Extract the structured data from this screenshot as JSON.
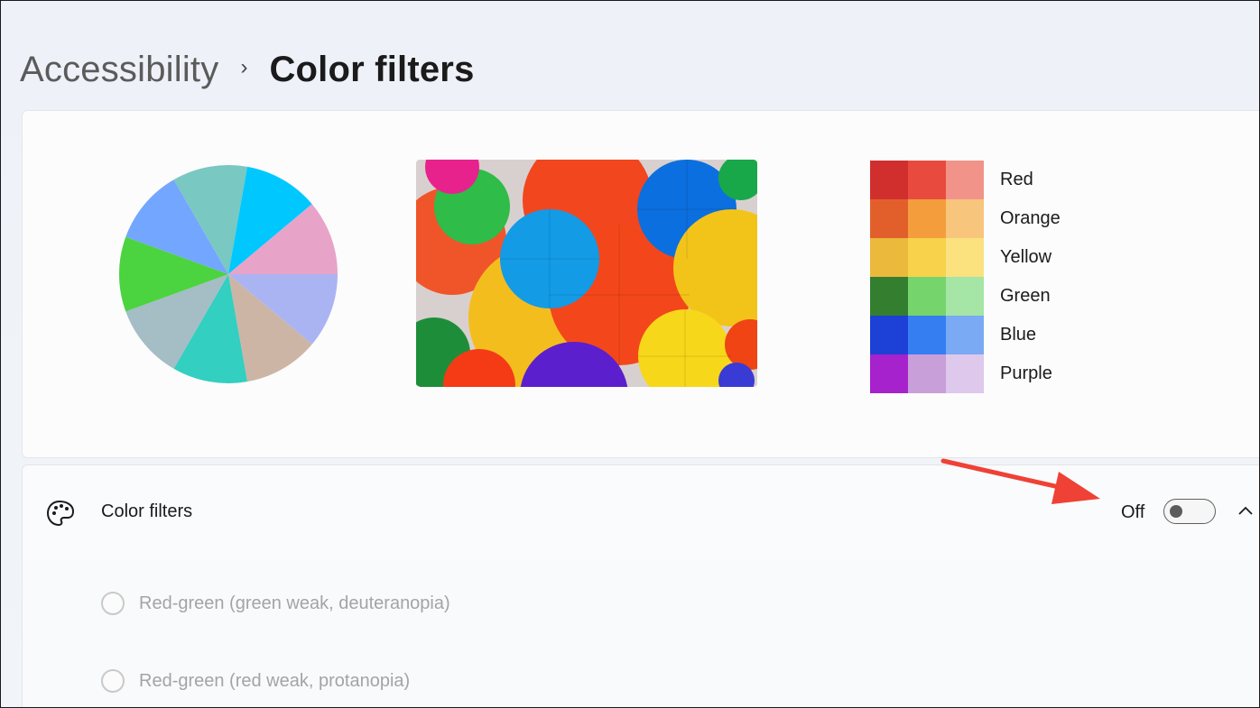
{
  "breadcrumb": {
    "parent": "Accessibility",
    "separator": "›",
    "current": "Color filters"
  },
  "preview": {
    "pie_colors": [
      "#abb4f2",
      "#cdb5a5",
      "#33cfc0",
      "#a5bdc5",
      "#4cd340",
      "#73a6ff",
      "#79c8c1",
      "#00c8ff",
      "#e8a3c8"
    ],
    "photo_description_icon": "colorful-paper-fans-image",
    "swatches": [
      {
        "label": "Red",
        "colors": [
          "#d12f2e",
          "#e84b3d",
          "#f2938a"
        ]
      },
      {
        "label": "Orange",
        "colors": [
          "#e25f2b",
          "#f39d3c",
          "#f8c57c"
        ]
      },
      {
        "label": "Yellow",
        "colors": [
          "#ebb93b",
          "#f8d24b",
          "#fbe27f"
        ]
      },
      {
        "label": "Green",
        "colors": [
          "#347e2f",
          "#75d46c",
          "#a5e5a6"
        ]
      },
      {
        "label": "Blue",
        "colors": [
          "#1d40d6",
          "#347ef2",
          "#7aaaf4"
        ]
      },
      {
        "label": "Purple",
        "colors": [
          "#a622cc",
          "#c89fd9",
          "#dec8ec"
        ]
      }
    ]
  },
  "color_filters": {
    "icon": "palette-icon",
    "title": "Color filters",
    "toggle_state": "Off",
    "toggle_on": false,
    "expand_icon": "chevron-up-icon"
  },
  "options": [
    {
      "label": "Red-green (green weak, deuteranopia)",
      "selected": false
    },
    {
      "label": "Red-green (red weak, protanopia)",
      "selected": false
    }
  ],
  "annotation": {
    "arrow_color": "#ef4136"
  }
}
